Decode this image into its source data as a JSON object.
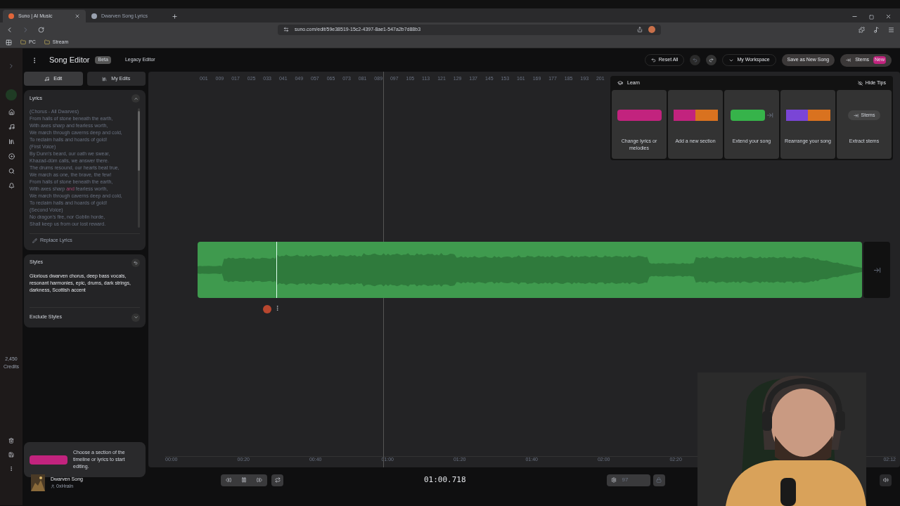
{
  "browser": {
    "tabs": [
      {
        "label": "Suno | AI Music",
        "selected": true
      },
      {
        "label": "Dwarven Song Lyrics",
        "selected": false
      }
    ],
    "address": "suno.com/edit/59e38519-15c2-4397-8ae1-547a2b7d88b3",
    "bookmarks": [
      "PC",
      "Stream"
    ]
  },
  "sidebar": {
    "credits_value": "2,450",
    "credits_label": "Credits"
  },
  "header": {
    "title": "Song Editor",
    "badge": "Beta",
    "legacy": "Legacy Editor",
    "reset": "Reset All",
    "workspace": "My Workspace",
    "save": "Save as New Song",
    "stems": "Stems",
    "stems_badge": "New"
  },
  "panel_tabs": [
    {
      "label": "Edit",
      "selected": true
    },
    {
      "label": "My Edits",
      "selected": false
    }
  ],
  "lyrics": {
    "title": "Lyrics",
    "expanded": true,
    "lines": [
      "(Chorus - All Dwarves)",
      "From halls of stone beneath the earth,",
      "With axes sharp and fearless worth,",
      "We march through caverns deep and cold,",
      "To reclaim halls and hoards of gold!",
      "(First Voice)",
      "By Dunn's beard, our oath we swear,",
      "Khazad-dûm calls, we answer there.",
      "The drums resound, our hearts beat true,",
      "We march as one, the brave, the few!",
      "From halls of stone beneath the earth,",
      "With axes sharp **and** fearless worth,",
      "We march through caverns deep and cold,",
      "To reclaim halls and hoards of gold!",
      "(Second Voice)",
      "No dragon's fire, nor Goblin horde,",
      "Shall keep us from our lost reward."
    ],
    "replace": "Replace Lyrics"
  },
  "styles": {
    "title": "Styles",
    "text": "Glorious dwarven chorus, deep bass vocals, resonant harmonies, epic, drums, dark strings, darkness, Scottish accent"
  },
  "exclude": {
    "title": "Exclude Styles",
    "expanded": false
  },
  "hint": "Choose a section of the timeline or lyrics to start editing.",
  "ruler": [
    "001",
    "009",
    "017",
    "025",
    "033",
    "041",
    "049",
    "057",
    "065",
    "073",
    "081",
    "089",
    "097",
    "105",
    "113",
    "121",
    "129",
    "137",
    "145",
    "153",
    "161",
    "169",
    "177",
    "185",
    "193",
    "201"
  ],
  "time_ruler": [
    "00:00",
    "00:20",
    "00:40",
    "01:00",
    "01:20",
    "01:40",
    "02:00",
    "02:20",
    "02:12"
  ],
  "learn": {
    "title": "Learn",
    "hide": "Hide Tips",
    "cards": [
      {
        "kind": "single",
        "label": "Change lyrics or melodies",
        "segments": [
          {
            "color": "#c2237e"
          }
        ]
      },
      {
        "kind": "split",
        "label": "Add a new section",
        "segments": [
          {
            "color": "#c2237e"
          },
          {
            "color": "#d9721f"
          }
        ]
      },
      {
        "kind": "extend",
        "label": "Extend your song",
        "segments": [
          {
            "color": "#36b34a"
          }
        ]
      },
      {
        "kind": "split",
        "label": "Rearrange your song",
        "segments": [
          {
            "color": "#7a45d6"
          },
          {
            "color": "#d9721f"
          }
        ]
      },
      {
        "kind": "stems",
        "label": "Extract stems",
        "button": "Stems"
      }
    ]
  },
  "player": {
    "song": "Dwarven Song",
    "artist": "0xHraln",
    "time": "01:00.718",
    "bpm": "97",
    "playing": true
  }
}
